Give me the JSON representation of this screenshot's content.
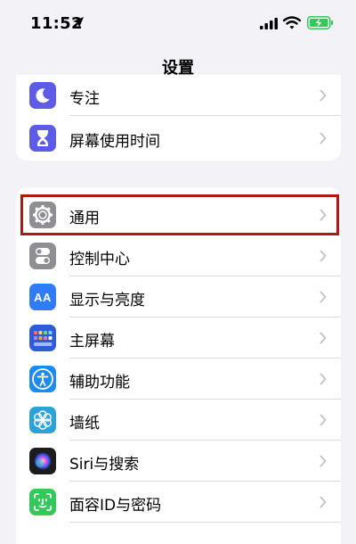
{
  "status_bar": {
    "time": "11:52",
    "icons": [
      "location-arrow-icon",
      "cellular-signal-icon",
      "wifi-icon",
      "battery-charging-icon"
    ],
    "battery_color": "#35c759"
  },
  "nav": {
    "title": "设置"
  },
  "groups": [
    {
      "items": [
        {
          "label": "专注",
          "icon": "moon-icon",
          "icon_bg": "#5e5ce6"
        },
        {
          "label": "屏幕使用时间",
          "icon": "hourglass-icon",
          "icon_bg": "#5e5ce6"
        }
      ]
    },
    {
      "items": [
        {
          "label": "通用",
          "icon": "gear-icon",
          "icon_bg": "#8e8e93",
          "highlighted": true
        },
        {
          "label": "控制中心",
          "icon": "toggles-icon",
          "icon_bg": "#8e8e93"
        },
        {
          "label": "显示与亮度",
          "icon": "text-size-icon",
          "icon_bg": "#2f7cf6"
        },
        {
          "label": "主屏幕",
          "icon": "home-screen-grid-icon",
          "icon_bg": "#2f5bd6"
        },
        {
          "label": "辅助功能",
          "icon": "accessibility-icon",
          "icon_bg": "#1a8cf0"
        },
        {
          "label": "墙纸",
          "icon": "flower-icon",
          "icon_bg": "#2aa3d9"
        },
        {
          "label": "Siri与搜索",
          "icon": "siri-icon",
          "icon_bg": "#1c1c1e"
        },
        {
          "label": "面容ID与密码",
          "icon": "face-id-icon",
          "icon_bg": "#34c759"
        }
      ]
    }
  ],
  "highlight_color": "#b01818",
  "icon_text": {
    "display": "AA"
  }
}
